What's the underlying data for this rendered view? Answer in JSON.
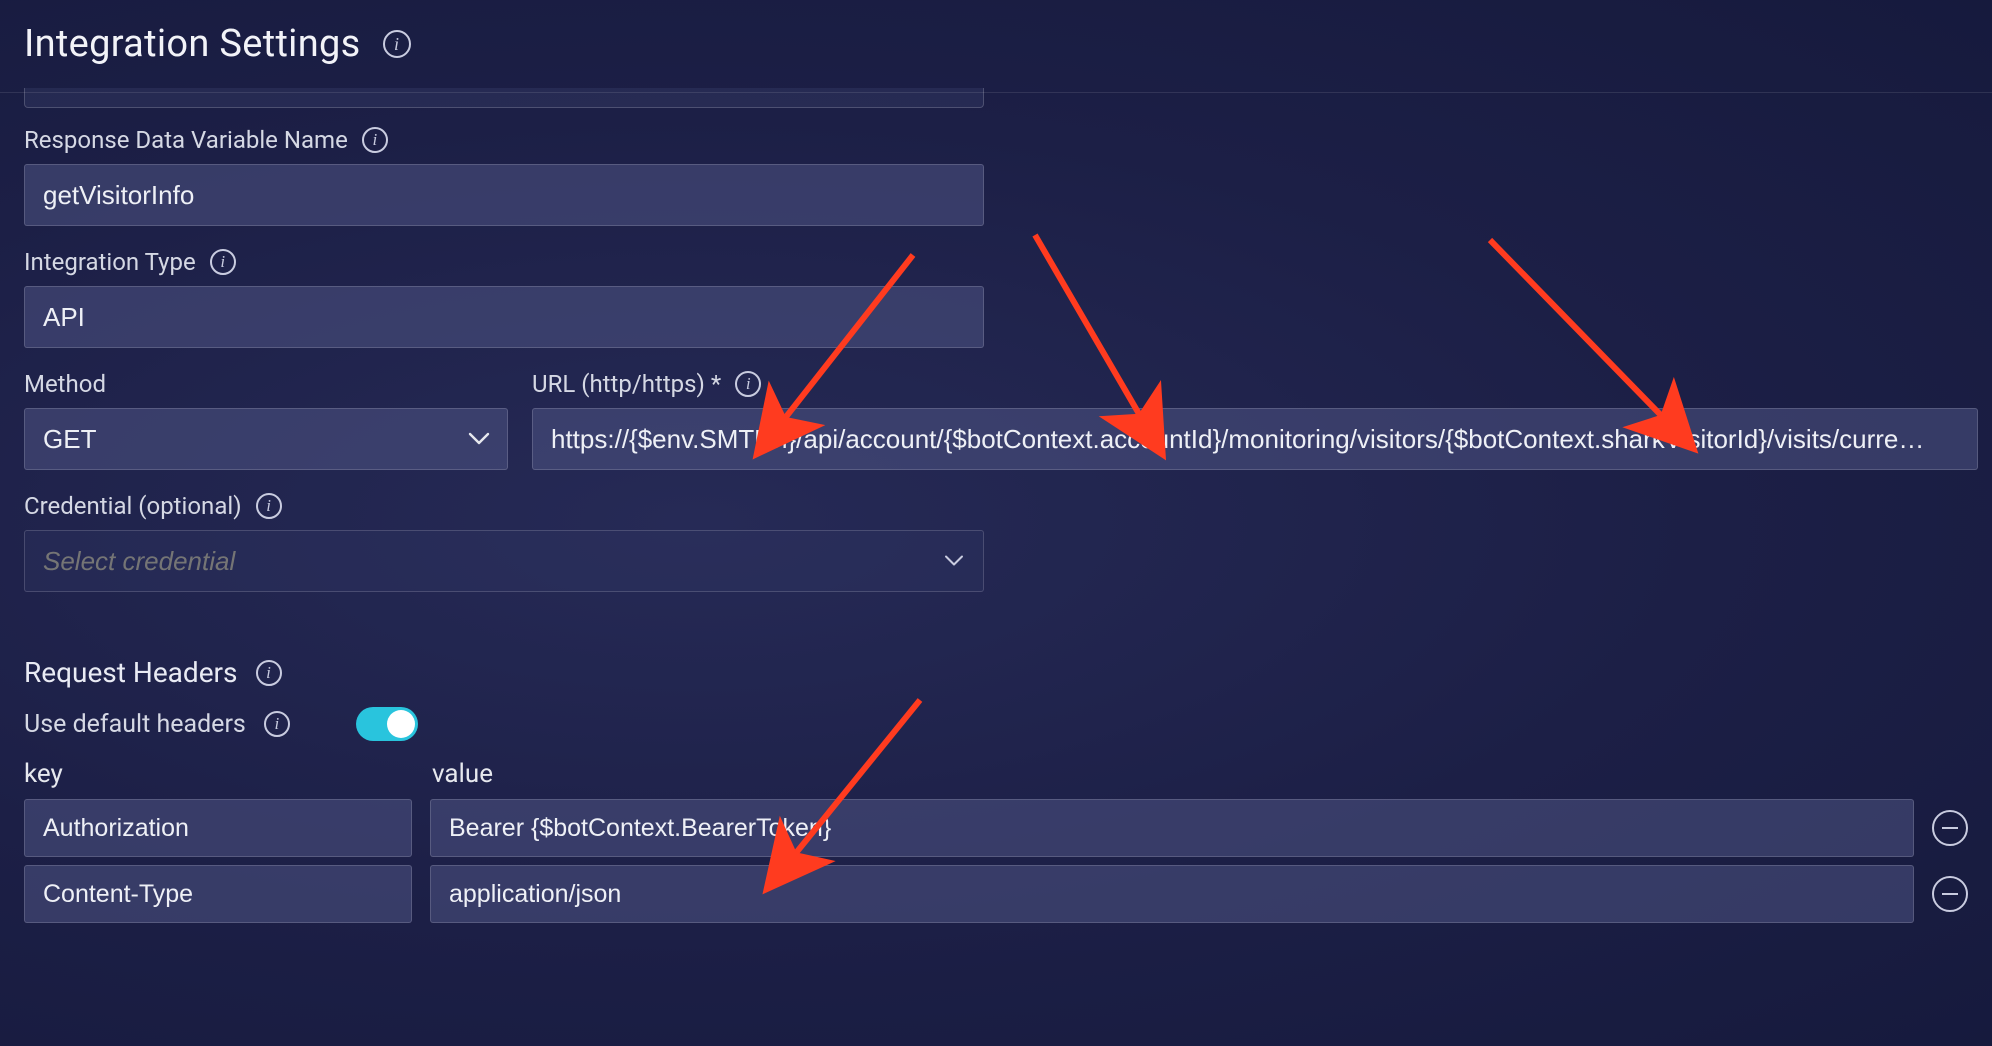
{
  "page": {
    "title": "Integration Settings"
  },
  "fields": {
    "response_var": {
      "label": "Response Data Variable Name",
      "value": "getVisitorInfo"
    },
    "integration_type": {
      "label": "Integration Type",
      "value": "API"
    },
    "method": {
      "label": "Method",
      "value": "GET"
    },
    "url": {
      "label": "URL (http/https) *",
      "value": "https://{$env.SMTUrl}/api/account/{$botContext.accountId}/monitoring/visitors/{$botContext.sharkVisitorId}/visits/curre…"
    },
    "credential": {
      "label": "Credential (optional)",
      "placeholder": "Select credential"
    }
  },
  "headers_section": {
    "title": "Request Headers",
    "use_default_label": "Use default headers",
    "use_default_on": true,
    "columns": {
      "key": "key",
      "value": "value"
    },
    "rows": [
      {
        "key": "Authorization",
        "value": "Bearer {$botContext.BearerToken}"
      },
      {
        "key": "Content-Type",
        "value": "application/json"
      }
    ]
  },
  "annotations": {
    "arrow_color": "#ff3b1f"
  }
}
